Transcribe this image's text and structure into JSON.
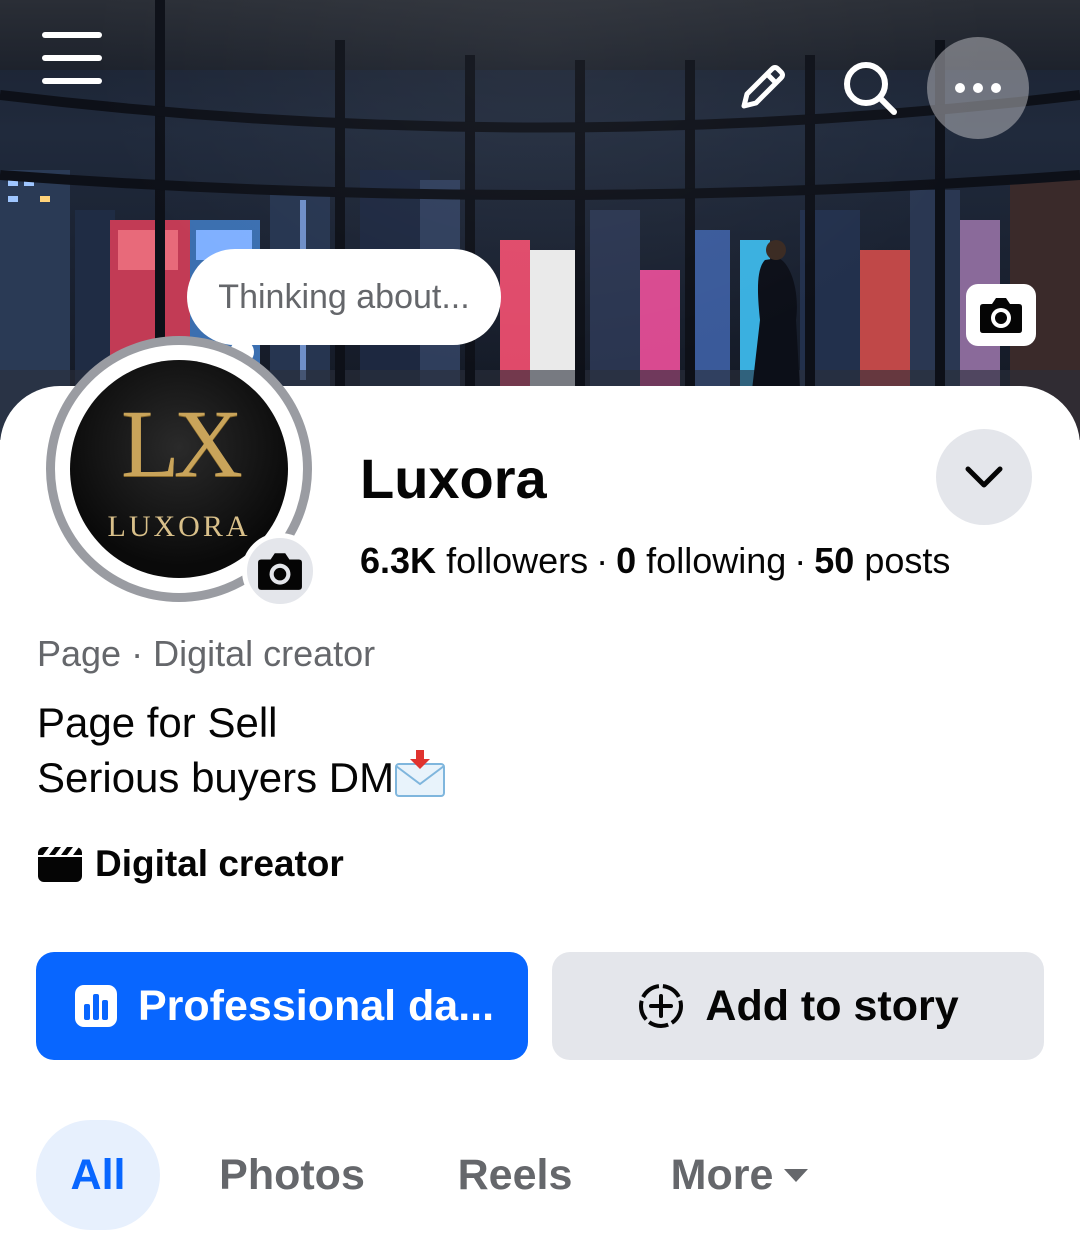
{
  "header": {
    "menu_icon": "hamburger-menu-icon",
    "edit_icon": "pencil-icon",
    "search_icon": "search-icon",
    "more_icon": "more-dots-icon",
    "cover_camera_icon": "camera-icon"
  },
  "status_bubble": {
    "placeholder": "Thinking about..."
  },
  "profile": {
    "avatar_monogram": "LX",
    "avatar_wordmark": "LUXORA",
    "name": "Luxora",
    "followers_count": "6.3K",
    "followers_label": "followers",
    "following_count": "0",
    "following_label": "following",
    "posts_count": "50",
    "posts_label": "posts",
    "separator": "·",
    "category": "Page · Digital creator",
    "bio_line1": "Page for Sell",
    "bio_line2": "Serious buyers DM",
    "bio_emoji_icon": "incoming-envelope-icon",
    "creator_label": "Digital creator",
    "creator_icon": "clapperboard-icon"
  },
  "actions": {
    "professional_label": "Professional da...",
    "professional_icon": "bar-chart-icon",
    "story_label": "Add to story",
    "story_icon": "add-circle-icon"
  },
  "tabs": [
    {
      "label": "All",
      "selected": true
    },
    {
      "label": "Photos",
      "selected": false
    },
    {
      "label": "Reels",
      "selected": false
    },
    {
      "label": "More",
      "selected": false
    }
  ],
  "colors": {
    "accent": "#0866ff",
    "secondary_button": "#e4e6eb",
    "selected_tab_bg": "#e7f0fd",
    "muted_text": "#65676b"
  }
}
